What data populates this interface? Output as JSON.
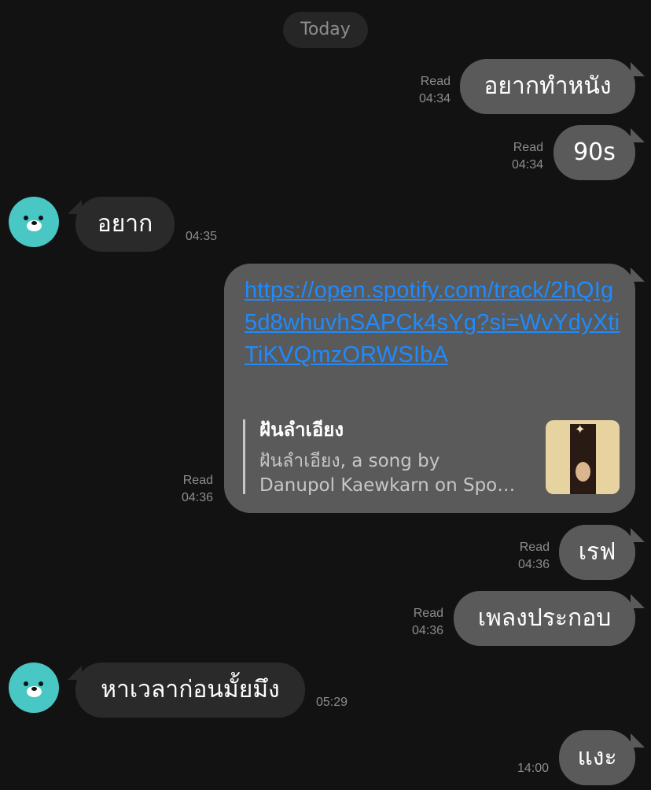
{
  "header": {
    "date_label": "Today"
  },
  "messages": [
    {
      "text": "อยากทำหนัง",
      "status": "Read",
      "time": "04:34"
    },
    {
      "text": "90s",
      "status": "Read",
      "time": "04:34"
    },
    {
      "text": "อยาก",
      "time": "04:35"
    },
    {
      "url": "https://open.spotify.com/track/2hQIg5d8whuvhSAPCk4sYg?si=WvYdyXtiTiKVQmzORWSIbA",
      "preview_title": "ฝันลำเอียง",
      "preview_desc": "ฝันลำเอียง, a song by\nDanupol Kaewkarn on Spo…",
      "status": "Read",
      "time": "04:36"
    },
    {
      "text": "เรฟ",
      "status": "Read",
      "time": "04:36"
    },
    {
      "text": "เพลงประกอบ",
      "status": "Read",
      "time": "04:36"
    },
    {
      "text": "หาเวลาก่อนมั้ยมึง",
      "time": "05:29"
    },
    {
      "text": "แงะ",
      "time": "14:00"
    }
  ],
  "colors": {
    "outgoing_bubble": "#5a5a5a",
    "incoming_bubble": "#2a2a2a",
    "avatar": "#48c7c4",
    "link": "#1e8bff"
  },
  "icons": {
    "avatar": "bear-avatar-icon",
    "album": "album-cover-thumbnail"
  }
}
